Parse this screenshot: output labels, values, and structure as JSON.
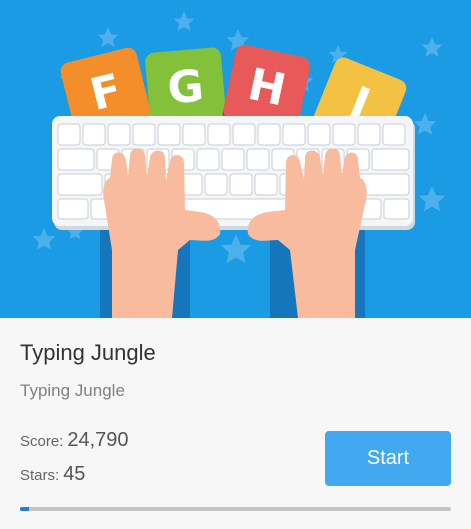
{
  "game": {
    "title": "Typing Jungle",
    "subtitle": "Typing Jungle",
    "score_label": "Score:",
    "score_value": "24,790",
    "stars_label": "Stars:",
    "stars_value": "45",
    "start_label": "Start",
    "progress_fraction": 0.02
  },
  "banner": {
    "letter_blocks": [
      "F",
      "G",
      "H",
      "J"
    ],
    "background_color": "#1a9be3"
  },
  "colors": {
    "accent": "#42a9f0",
    "progress_fill": "#1e7fe0",
    "progress_track": "#c4c4c4"
  }
}
